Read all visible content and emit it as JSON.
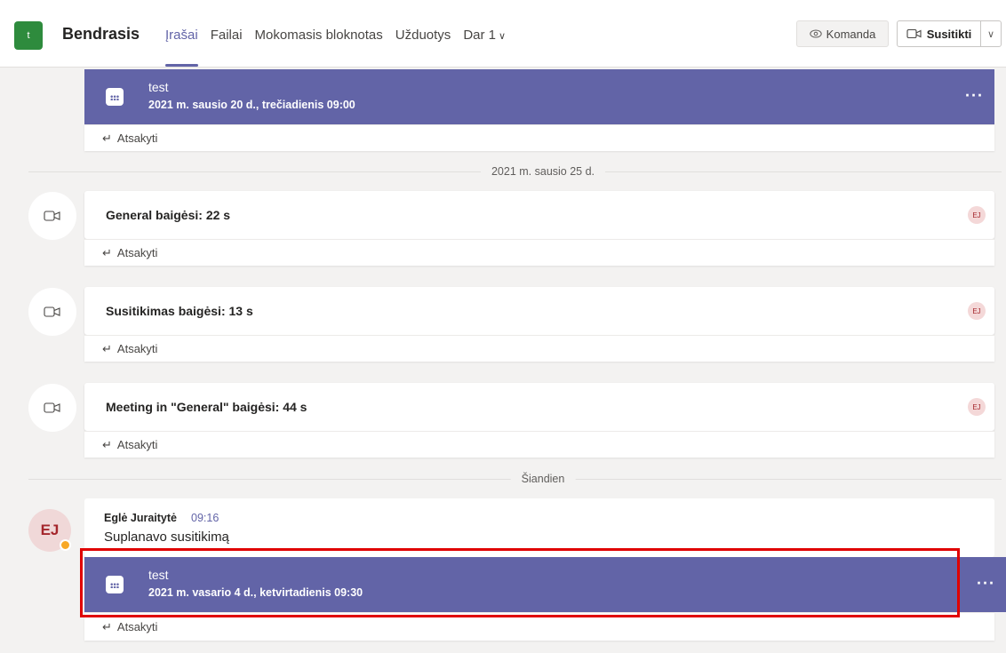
{
  "header": {
    "team_initial": "t",
    "team_name": "Bendrasis",
    "tabs": [
      {
        "label": "Įrašai"
      },
      {
        "label": "Failai"
      },
      {
        "label": "Mokomasis bloknotas"
      },
      {
        "label": "Užduotys"
      },
      {
        "label": "Dar 1"
      }
    ],
    "team_button": "Komanda",
    "meet_button": "Susitikti"
  },
  "feed": {
    "meeting1": {
      "title": "test",
      "datetime": "2021 m. sausio 20 d., trečiadienis 09:00",
      "reply": "Atsakyti"
    },
    "separator1": "2021 m. sausio 25 d.",
    "events": [
      {
        "text": "General baigėsi: 22 s",
        "avatar": "EJ",
        "reply": "Atsakyti"
      },
      {
        "text": "Susitikimas baigėsi: 13 s",
        "avatar": "EJ",
        "reply": "Atsakyti"
      },
      {
        "text": "Meeting in \"General\" baigėsi: 44 s",
        "avatar": "EJ",
        "reply": "Atsakyti"
      }
    ],
    "separator2": "Šiandien",
    "message": {
      "avatar": "EJ",
      "author": "Eglė Juraitytė",
      "time": "09:16",
      "text": "Suplanavo susitikimą",
      "meeting": {
        "title": "test",
        "datetime": "2021 m. vasario 4 d., ketvirtadienis 09:30"
      },
      "reply": "Atsakyti"
    }
  },
  "colors": {
    "accent": "#6264a7",
    "highlight": "#e00000",
    "team": "#2e8b3d"
  }
}
